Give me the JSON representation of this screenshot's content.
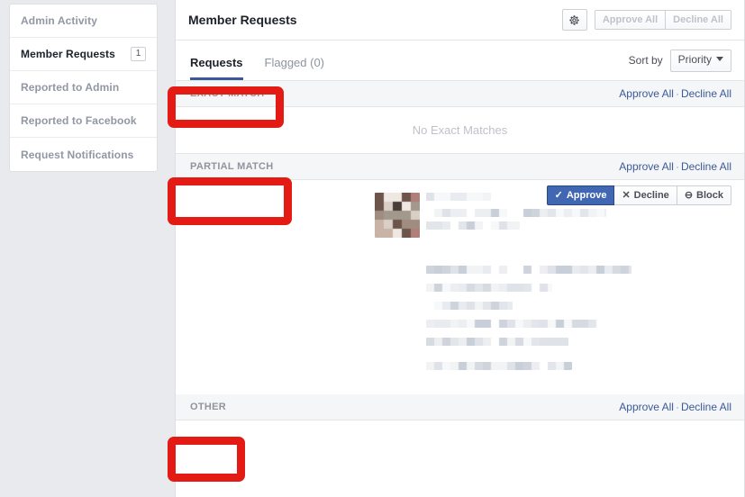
{
  "sidebar": {
    "items": [
      {
        "label": "Admin Activity",
        "badge": "",
        "active": false
      },
      {
        "label": "Member Requests",
        "badge": "1",
        "active": true
      },
      {
        "label": "Reported to Admin",
        "badge": "",
        "active": false
      },
      {
        "label": "Reported to Facebook",
        "badge": "",
        "active": false
      },
      {
        "label": "Request Notifications",
        "badge": "",
        "active": false
      }
    ]
  },
  "header": {
    "title": "Member Requests",
    "gear_icon": "gear-icon",
    "approve_all_label": "Approve All",
    "decline_all_label": "Decline All"
  },
  "tabs": {
    "requests_label": "Requests",
    "flagged_label": "Flagged (0)",
    "sort_by_label": "Sort by",
    "sort_value": "Priority",
    "caret_icon": "chevron-down-icon"
  },
  "sections": {
    "exact": {
      "title": "EXACT MATCH",
      "approve_all": "Approve All",
      "decline_all": "Decline All",
      "separator": "·",
      "empty_message": "No Exact Matches"
    },
    "partial": {
      "title": "PARTIAL MATCH",
      "approve_all": "Approve All",
      "decline_all": "Decline All",
      "separator": "·"
    },
    "other": {
      "title": "OTHER",
      "approve_all": "Approve All",
      "decline_all": "Decline All",
      "separator": "·"
    }
  },
  "request_actions": {
    "approve_label": "Approve",
    "approve_icon": "check-icon",
    "approve_glyph": "✓",
    "decline_label": "Decline",
    "decline_icon": "x-icon",
    "decline_glyph": "✕",
    "block_label": "Block",
    "block_icon": "minus-circle-icon",
    "block_glyph": "⊖"
  },
  "colors": {
    "page_background": "#e9eaed",
    "panel_background": "#ffffff",
    "link_blue": "#3b5998",
    "primary_button": "#4267b2",
    "active_tab_underline": "#3b5998",
    "annotation_red": "#e31b14",
    "muted_text": "#90949c",
    "section_header_bg": "#f5f6f7"
  },
  "annotations": [
    {
      "target": "EXACT MATCH"
    },
    {
      "target": "PARTIAL MATCH"
    },
    {
      "target": "OTHER"
    }
  ]
}
